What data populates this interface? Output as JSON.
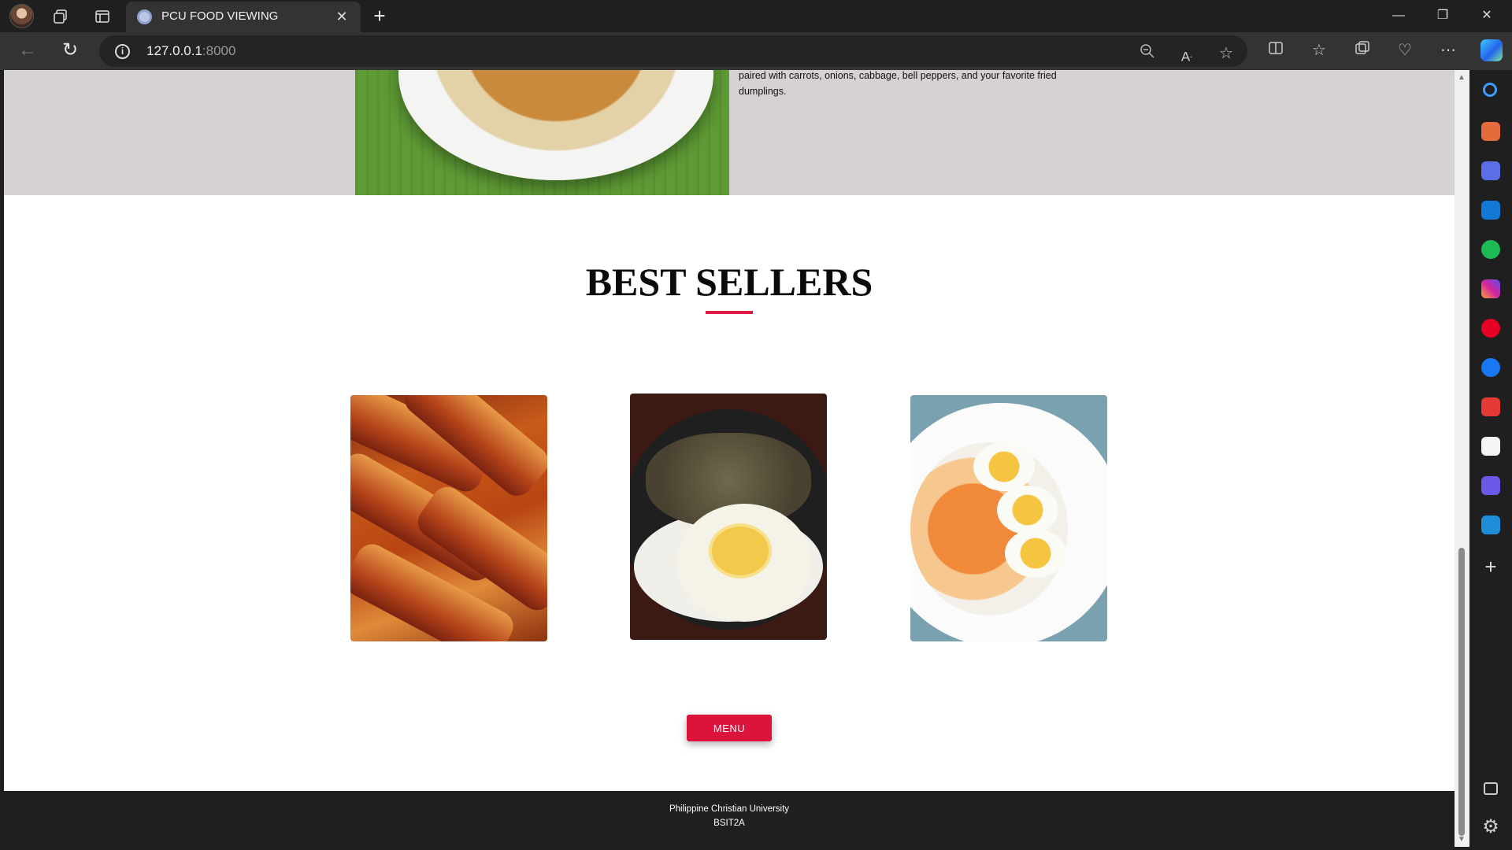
{
  "browser": {
    "tab_title": "PCU FOOD VIEWING",
    "url_host": "127.0.0.1",
    "url_port": ":8000"
  },
  "hero": {
    "description": "paired with carrots, onions, cabbage, bell peppers, and your favorite fried dumplings."
  },
  "best_sellers": {
    "title": "BEST SELLERS",
    "items": [
      {
        "icon": "lumpia-dish-image"
      },
      {
        "icon": "sisig-rice-egg-image"
      },
      {
        "icon": "pancit-palabok-image"
      }
    ]
  },
  "menu_button": {
    "label": "MENU"
  },
  "footer": {
    "line1": "Philippine Christian University",
    "line2": "BSIT2A"
  },
  "colors": {
    "accent": "#dc143c",
    "hero_band": "#d6d1d3",
    "footer_bg": "#1f1f1f",
    "chrome_bg": "#333333"
  }
}
